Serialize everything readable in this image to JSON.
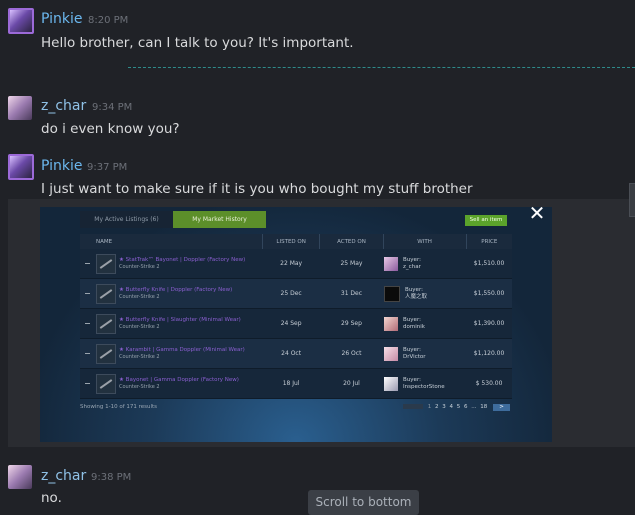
{
  "messages": [
    {
      "user": "Pinkie",
      "time": "8:20 PM",
      "text": "Hello brother, can I talk to you? It's important."
    },
    {
      "user": "z_char",
      "time": "9:34 PM",
      "text": "do i even know you?"
    },
    {
      "user": "Pinkie",
      "time": "9:37 PM",
      "text": "I just want to make sure if it is you who bought my stuff brother"
    },
    {
      "user": "z_char",
      "time": "9:38 PM",
      "text": "no."
    }
  ],
  "market": {
    "tab_active_listings": "My Active Listings (6)",
    "tab_market_history": "My Market History",
    "sell_button": "Sell an item",
    "close_symbol": "✕",
    "columns": [
      "NAME",
      "LISTED ON",
      "ACTED ON",
      "WITH",
      "PRICE"
    ],
    "rows": [
      {
        "name": "★ StatTrak™ Bayonet | Doppler (Factory New)",
        "game": "Counter-Strike 2",
        "listed": "22 May",
        "acted": "25 May",
        "buyer_label": "Buyer:",
        "buyer": "z_char",
        "price": "$1,510.00"
      },
      {
        "name": "★ Butterfly Knife | Doppler (Factory New)",
        "game": "Counter-Strike 2",
        "listed": "25 Dec",
        "acted": "31 Dec",
        "buyer_label": "Buyer:",
        "buyer": "人魔之取",
        "price": "$1,550.00"
      },
      {
        "name": "★ Butterfly Knife | Slaughter (Minimal Wear)",
        "game": "Counter-Strike 2",
        "listed": "24 Sep",
        "acted": "29 Sep",
        "buyer_label": "Buyer:",
        "buyer": "dominik",
        "price": "$1,390.00"
      },
      {
        "name": "★ Karambit | Gamma Doppler (Minimal Wear)",
        "game": "Counter-Strike 2",
        "listed": "24 Oct",
        "acted": "26 Oct",
        "buyer_label": "Buyer:",
        "buyer": "DrVictor",
        "price": "$1,120.00"
      },
      {
        "name": "★ Bayonet | Gamma Doppler (Factory New)",
        "game": "Counter-Strike 2",
        "listed": "18 Jul",
        "acted": "20 Jul",
        "buyer_label": "Buyer:",
        "buyer": "InspectorStone",
        "price": "$ 530.00"
      }
    ],
    "showing": "Showing 1-10 of 171 results",
    "pages": [
      "1",
      "2",
      "3",
      "4",
      "5",
      "6",
      "...",
      "18"
    ],
    "next_symbol": ">"
  },
  "scroll_to_bottom": "Scroll to bottom"
}
